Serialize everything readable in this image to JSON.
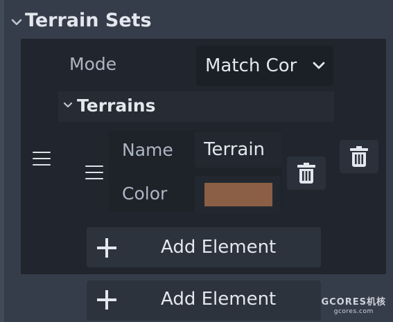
{
  "inspector": {
    "section_title": "Terrain Sets",
    "mode_label": "Mode",
    "mode_value": "Match Cor",
    "terrains_title": "Terrains",
    "terrain": {
      "name_label": "Name",
      "name_value": "Terrain",
      "color_label": "Color",
      "color_value": "#8b5f45"
    },
    "add_element_inner": "Add Element",
    "add_element_outer": "Add Element"
  },
  "icons": {
    "section_chevron": "chevron-down-icon",
    "terrains_chevron": "chevron-down-icon",
    "dropdown_chevron": "chevron-down-icon",
    "drag_handle": "menu-icon",
    "delete": "trash-icon",
    "add": "plus-icon"
  },
  "watermark": {
    "brand": "GCORES机核",
    "url": "gcores.com"
  }
}
